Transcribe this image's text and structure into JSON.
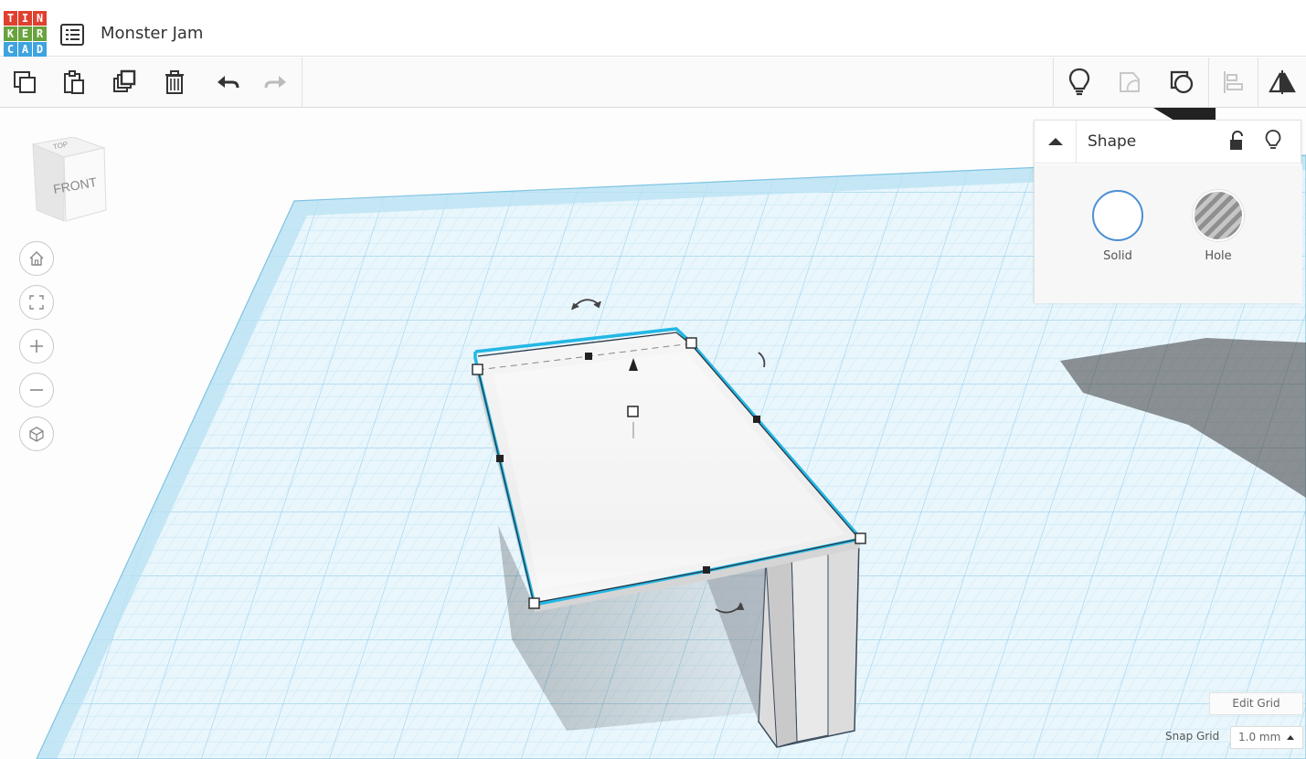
{
  "app": {
    "logo_letters": [
      "T",
      "I",
      "N",
      "K",
      "E",
      "R",
      "C",
      "A",
      "D"
    ],
    "logo_colors": [
      "#e0402f",
      "#e0402f",
      "#e0402f",
      "#68a33e",
      "#68a33e",
      "#68a33e",
      "#3ea3e0",
      "#3ea3e0",
      "#3ea3e0"
    ],
    "project_title": "Monster Jam"
  },
  "toolbar": {
    "left_icons": [
      "copy-icon",
      "paste-icon",
      "duplicate-icon",
      "delete-icon",
      "undo-icon",
      "redo-icon"
    ],
    "right_icons": [
      "lightbulb-icon",
      "group-icon",
      "ungroup-icon",
      "align-icon",
      "mirror-icon"
    ]
  },
  "viewcube": {
    "top_label": "TOP",
    "front_label": "FRONT"
  },
  "nav": [
    "home-view-icon",
    "fit-view-icon",
    "zoom-in-icon",
    "zoom-out-icon",
    "ortho-view-icon"
  ],
  "shape_panel": {
    "title": "Shape",
    "solid_label": "Solid",
    "hole_label": "Hole",
    "accent": "#4a8fd6"
  },
  "grid": {
    "edit_label": "Edit Grid",
    "snap_label": "Snap Grid",
    "snap_value": "1.0 mm"
  },
  "colors": {
    "grid_line": "#a8d7ee",
    "grid_fill": "#e4f4fb",
    "selection": "#23b7e5"
  }
}
